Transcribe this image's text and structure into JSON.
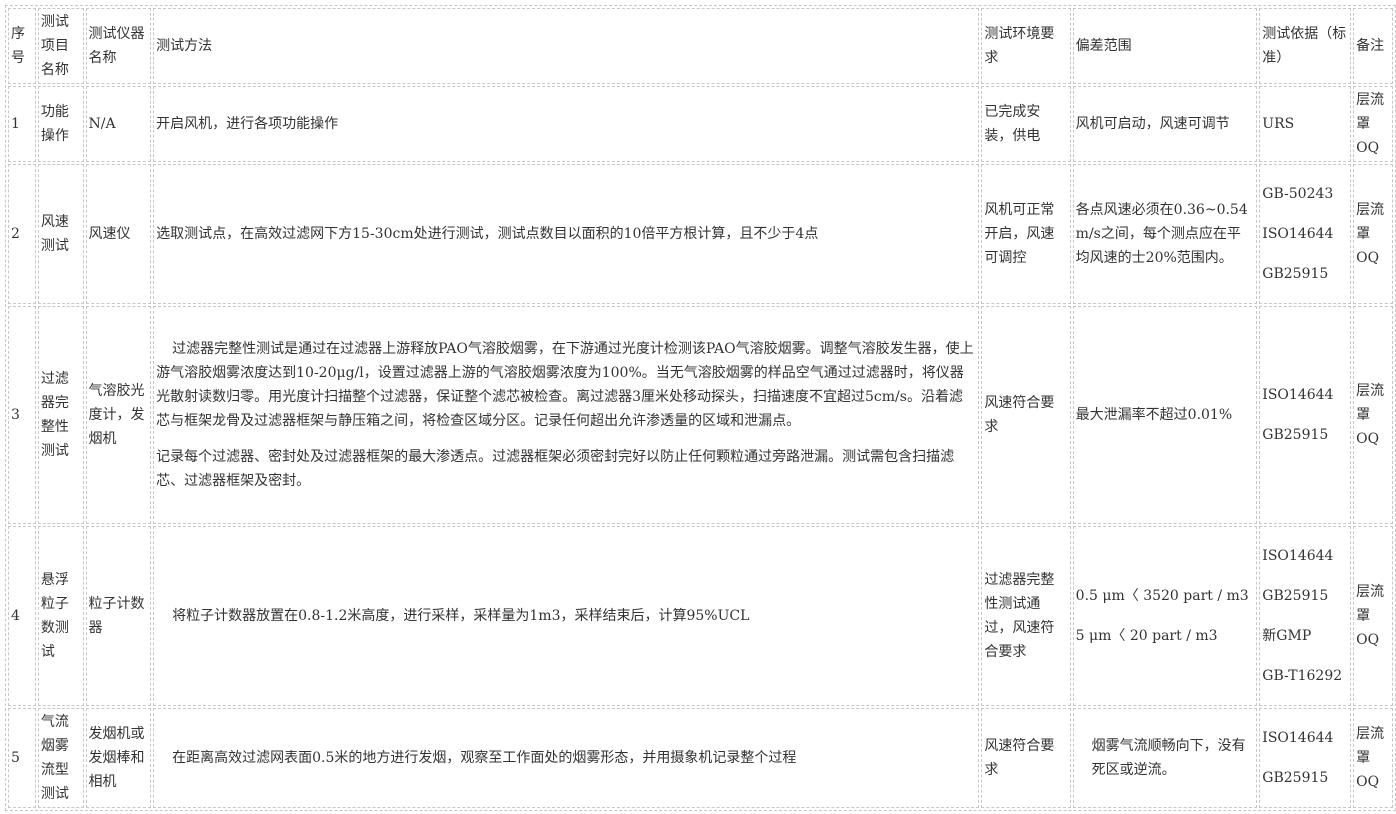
{
  "header": {
    "no": "序号",
    "item": "测试项目名称",
    "instrument": "测试仪器名称",
    "method": "测试方法",
    "env": "测试环境要求",
    "deviation": "偏差范围",
    "basis": "测试依据（标准）",
    "note": "备注"
  },
  "rows": [
    {
      "no": "1",
      "item": "功能操作",
      "instrument": "N/A",
      "method": [
        "开启风机，进行各项功能操作"
      ],
      "env": "已完成安装，供电",
      "deviation": [
        "风机可启动，风速可调节"
      ],
      "basis": [
        "URS"
      ],
      "note": "层流罩OQ"
    },
    {
      "no": "2",
      "item": "风速测试",
      "instrument": "风速仪",
      "method": [
        "选取测试点，在高效过滤网下方15-30cm处进行测试，测试点数目以面积的10倍平方根计算，且不少于4点"
      ],
      "env": "风机可正常开启，风速可调控",
      "deviation": [
        "各点风速必须在0.36~0.54 m/s之间，每个测点应在平均风速的士20%范围内。"
      ],
      "basis": [
        "GB-50243",
        "ISO14644",
        "GB25915"
      ],
      "note": "层流罩OQ"
    },
    {
      "no": "3",
      "item": "过滤器完整性测试",
      "instrument": "气溶胶光度计，发烟机",
      "method": [
        "过滤器完整性测试是通过在过滤器上游释放PAO气溶胶烟雾，在下游通过光度计检测该PAO气溶胶烟雾。调整气溶胶发生器，使上游气溶胶烟雾浓度达到10-20μg/l，设置过滤器上游的气溶胶烟雾浓度为100%。当无气溶胶烟雾的样品空气通过过滤器时，将仪器光散射读数归零。用光度计扫描整个过滤器，保证整个滤芯被检查。离过滤器3厘米处移动探头，扫描速度不宜超过5cm/s。沿着滤芯与框架龙骨及过滤器框架与静压箱之间，将检查区域分区。记录任何超出允许渗透量的区域和泄漏点。",
        "记录每个过滤器、密封处及过滤器框架的最大渗透点。过滤器框架必须密封完好以防止任何颗粒通过旁路泄漏。测试需包含扫描滤芯、过滤器框架及密封。"
      ],
      "env": "风速符合要求",
      "deviation": [
        "最大泄漏率不超过0.01%"
      ],
      "basis": [
        "ISO14644",
        "GB25915"
      ],
      "note": "层流罩OQ"
    },
    {
      "no": "4",
      "item": "悬浮粒子数测试",
      "instrument": "粒子计数器",
      "method": [
        "将粒子计数器放置在0.8-1.2米高度，进行采样，采样量为1m3，采样结束后，计算95%UCL"
      ],
      "env": "过滤器完整性测试通过，风速符合要求",
      "deviation": [
        "0.5 μm〈 3520 part / m3",
        "5 μm〈 20 part / m3"
      ],
      "basis": [
        "ISO14644",
        "GB25915",
        "新GMP",
        "GB-T16292"
      ],
      "note": "层流罩OQ"
    },
    {
      "no": "5",
      "item": "气流烟雾流型测试",
      "instrument": "发烟机或发烟棒和相机",
      "method": [
        "在距离高效过滤网表面0.5米的地方进行发烟，观察至工作面处的烟雾形态，并用摄象机记录整个过程"
      ],
      "env": "风速符合要求",
      "deviation": [
        "烟雾气流顺畅向下，没有死区或逆流。"
      ],
      "basis": [
        "ISO14644",
        "GB25915"
      ],
      "note": "层流罩OQ"
    }
  ]
}
